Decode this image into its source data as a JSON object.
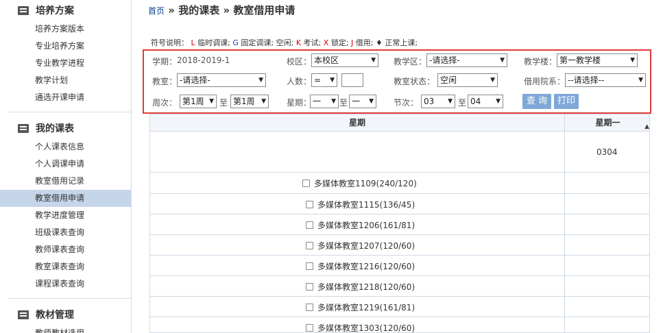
{
  "sidebar": {
    "sections": [
      {
        "title": "培养方案",
        "items": [
          "培养方案版本",
          "专业培养方案",
          "专业教学进程",
          "教学计划",
          "通选开课申请"
        ]
      },
      {
        "title": "我的课表",
        "items": [
          "个人课表信息",
          "个人调课申请",
          "教室借用记录",
          "教室借用申请",
          "教学进度管理",
          "班级课表查询",
          "教师课表查询",
          "教室课表查询",
          "课程课表查询"
        ]
      },
      {
        "title": "教材管理",
        "items": [
          "教师教材选用"
        ]
      }
    ]
  },
  "breadcrumb": {
    "home": "首页",
    "sep1": "»",
    "level1": "我的课表",
    "sep2": "»",
    "level2": "教室借用申请"
  },
  "legend": {
    "label": "符号说明：",
    "items": [
      {
        "sym": "L",
        "text": "临时调课;"
      },
      {
        "sym": "G",
        "text": "固定调课;"
      },
      {
        "sym": "",
        "text": "空闲;"
      },
      {
        "sym": "K",
        "text": "考试;"
      },
      {
        "sym": "X",
        "text": "锁定;"
      },
      {
        "sym": "J",
        "text": "借用;"
      },
      {
        "sym": "♦",
        "text": "正常上课;"
      }
    ]
  },
  "filter": {
    "term_label": "学期：",
    "term_value": "2018-2019-1",
    "campus_label": "校区：",
    "campus_value": "本校区",
    "teach_area_label": "教学区：",
    "teach_area_value": "-请选择-",
    "building_label": "教学楼：",
    "building_value": "第一教学楼",
    "room_label": "教室：",
    "room_value": "-请选择-",
    "people_label": "人数：",
    "people_op": "=",
    "people_value": "",
    "room_status_label": "教室状态：",
    "room_status_value": "空闲",
    "dept_label": "借用院系：",
    "dept_value": "--请选择--",
    "week_label": "周次：",
    "week_from": "第1周",
    "to1": "至",
    "week_to": "第1周",
    "day_label": "星期：",
    "day_from": "一",
    "to2": "至",
    "day_to": "一",
    "section_label": "节次：",
    "section_from": "03",
    "to3": "至",
    "section_to": "04",
    "query_btn": "查 询",
    "print_btn": "打印"
  },
  "table": {
    "col1": "星期",
    "col2": "星期一",
    "code": "0304",
    "rooms": [
      "多媒体教室1109(240/120)",
      "多媒体教室1115(136/45)",
      "多媒体教室1206(161/81)",
      "多媒体教室1207(120/60)",
      "多媒体教室1216(120/60)",
      "多媒体教室1218(120/60)",
      "多媒体教室1219(161/81)",
      "多媒体教室1303(120/60)"
    ]
  }
}
